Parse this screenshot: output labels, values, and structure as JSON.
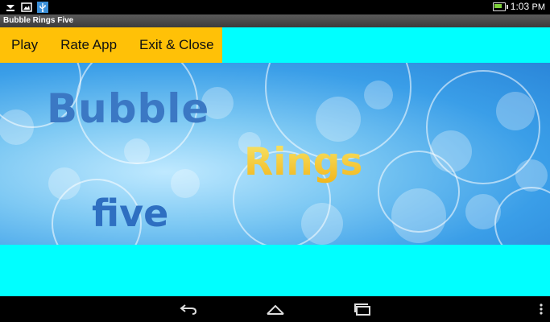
{
  "status_bar": {
    "time": "1:03",
    "time_suffix": "PM",
    "left_icons": [
      "download-icon",
      "image-icon",
      "usb-icon"
    ],
    "battery_color": "#7ccf3a"
  },
  "window": {
    "title": "Bubble Rings Five"
  },
  "menu": {
    "items": [
      {
        "label": "Play"
      },
      {
        "label": "Rate App"
      },
      {
        "label": "Exit & Close"
      }
    ],
    "background": "#ffc107"
  },
  "banner": {
    "line1": "Bubble",
    "line2": "Rings",
    "line3": "five"
  },
  "colors": {
    "app_background": "#00ffff",
    "status_bar": "#000000",
    "nav_bar": "#000000"
  },
  "nav_bar": {
    "buttons": [
      "back-icon",
      "home-icon",
      "recent-apps-icon",
      "overflow-menu-icon"
    ]
  }
}
